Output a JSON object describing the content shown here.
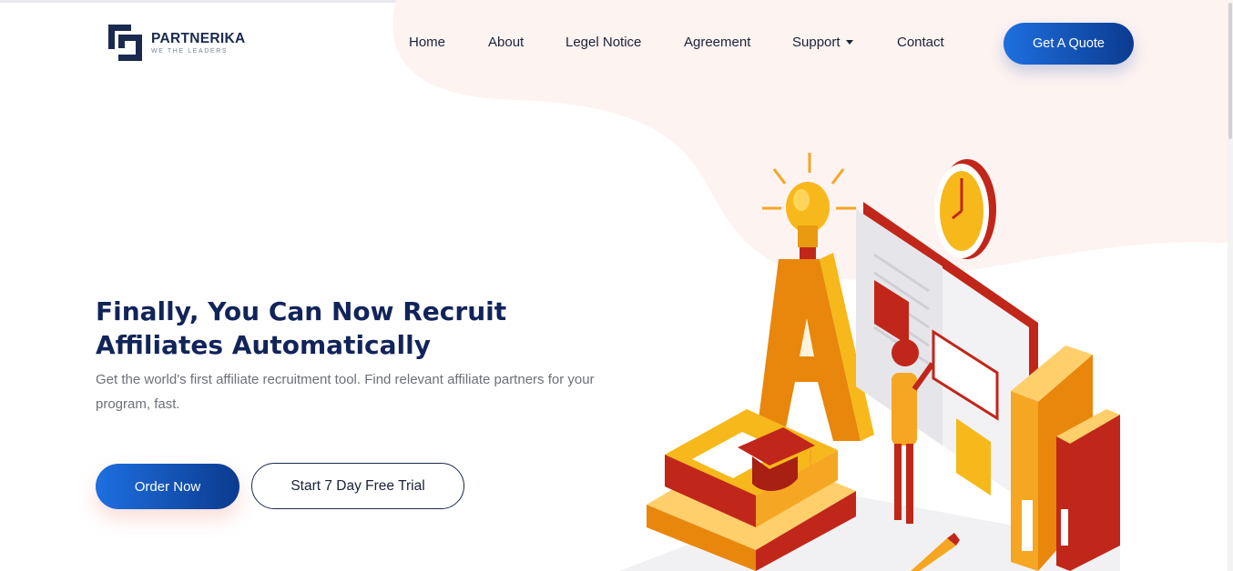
{
  "brand": {
    "name": "PARTNERIKA",
    "tagline": "WE THE LEADERS"
  },
  "nav": {
    "items": [
      {
        "label": "Home"
      },
      {
        "label": "About"
      },
      {
        "label": "Legel Notice"
      },
      {
        "label": "Agreement"
      },
      {
        "label": "Support",
        "has_dropdown": true
      },
      {
        "label": "Contact"
      }
    ],
    "cta_label": "Get A Quote"
  },
  "hero": {
    "title_line1": "Finally, You Can Now Recruit",
    "title_line2": "Affiliates Automatically",
    "subtitle": "Get the world's first affiliate recruitment tool. Find relevant affiliate partners for your program, fast.",
    "primary_button": "Order Now",
    "secondary_button": "Start 7 Day Free Trial"
  },
  "colors": {
    "navy": "#11245a",
    "brand_blue": "#1e6fe0",
    "brand_blue_dark": "#0b3b8f",
    "blob_pink": "#fdf3f1",
    "accent_orange": "#f5a623",
    "accent_red": "#c0271a"
  }
}
